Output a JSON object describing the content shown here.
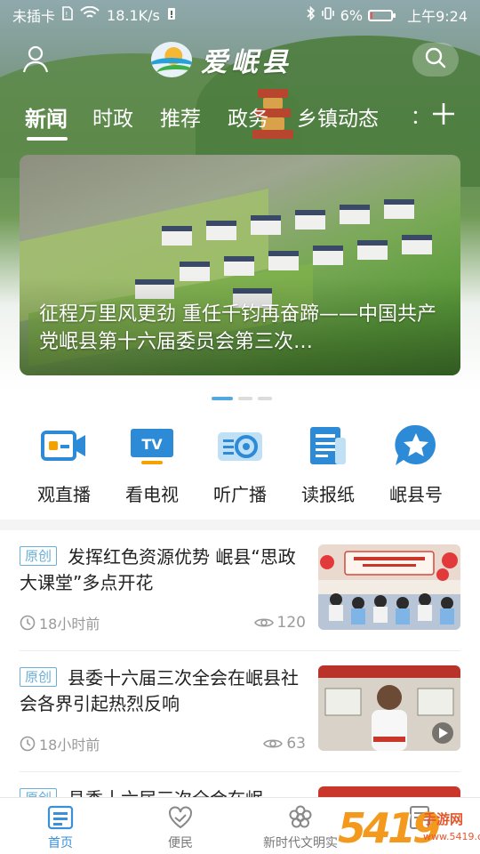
{
  "status_bar": {
    "carrier": "未插卡",
    "speed": "18.1K/s",
    "battery": "6%",
    "time": "上午9:24"
  },
  "header": {
    "logo_text": "爱岷县"
  },
  "tabs": {
    "items": [
      "新闻",
      "时政",
      "推荐",
      "政务",
      "乡镇动态"
    ],
    "active": "新闻",
    "more": "：",
    "add_label": "+"
  },
  "banner": {
    "title": "征程万里风更劲 重任千钧再奋蹄——中国共产党岷县第十六届委员会第三次…",
    "slide_count": 3,
    "active_slide": 1
  },
  "services": [
    {
      "label": "观直播",
      "icon": "live-camera-icon"
    },
    {
      "label": "看电视",
      "icon": "tv-icon"
    },
    {
      "label": "听广播",
      "icon": "radio-icon"
    },
    {
      "label": "读报纸",
      "icon": "newspaper-icon"
    },
    {
      "label": "岷县号",
      "icon": "star-account-icon"
    }
  ],
  "news": [
    {
      "badge": "原创",
      "title": "发挥红色资源优势 岷县“思政大课堂”多点开花",
      "time": "18小时前",
      "views": "120"
    },
    {
      "badge": "原创",
      "title": "县委十六届三次全会在岷县社会各界引起热烈反响",
      "time": "18小时前",
      "views": "63"
    },
    {
      "badge": "原创",
      "title": "县委十六届三次全会在岷",
      "time": "",
      "views": ""
    }
  ],
  "bottom_nav": [
    {
      "label": "首页",
      "icon": "home-icon",
      "active": true
    },
    {
      "label": "便民",
      "icon": "heart-hands-icon",
      "active": false
    },
    {
      "label": "新时代文明实",
      "icon": "flower-icon",
      "active": false
    },
    {
      "label": "",
      "icon": "document-icon",
      "active": false
    }
  ],
  "watermark": {
    "big": "5419",
    "small": "手游网",
    "url": "www.5419.com"
  },
  "colors": {
    "accent": "#3a8fd6",
    "badge": "#6aaed6",
    "service_icon": "#2d8ad6"
  }
}
